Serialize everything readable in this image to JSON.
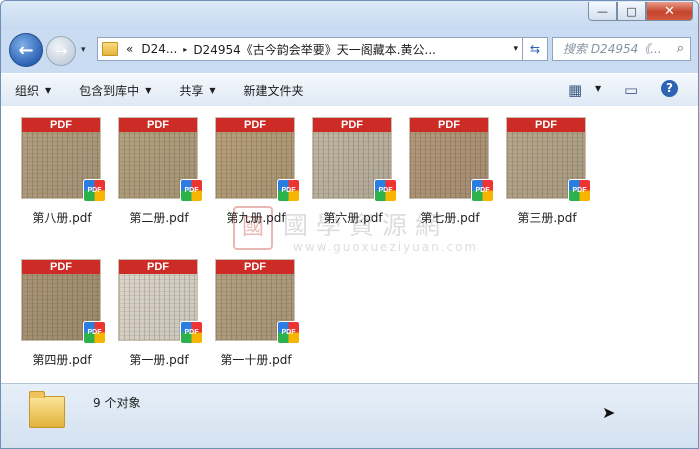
{
  "window": {
    "controls": {
      "minimize": "—",
      "maximize": "□",
      "close": "✕"
    }
  },
  "nav": {
    "back": "←",
    "forward": "→",
    "history": "▾",
    "breadcrumb": [
      "«",
      "D24...",
      "D24954《古今韵会举要》天一阁藏本.黄公..."
    ],
    "separators": [
      "▸"
    ],
    "address_dropdown": "▾",
    "refresh": "⇆",
    "search_placeholder": "搜索 D24954《...",
    "search_icon": "⌕"
  },
  "toolbar": {
    "organize": "组织",
    "include_library": "包含到库中",
    "share": "共享",
    "new_folder": "新建文件夹",
    "dropdown_arrow": "▼",
    "view_icon": "▦",
    "view_arrow": "▼",
    "pane_icon": "▭",
    "help_icon": "?"
  },
  "files": [
    {
      "name": "第八册.pdf",
      "band": "PDF",
      "badge": "PDF",
      "tone": "#b29e80"
    },
    {
      "name": "第二册.pdf",
      "band": "PDF",
      "badge": "PDF",
      "tone": "#b3a17f"
    },
    {
      "name": "第九册.pdf",
      "band": "PDF",
      "badge": "PDF",
      "tone": "#b69f7a"
    },
    {
      "name": "第六册.pdf",
      "band": "PDF",
      "badge": "PDF",
      "tone": "#bfb6a3"
    },
    {
      "name": "第七册.pdf",
      "band": "PDF",
      "badge": "PDF",
      "tone": "#b2987b"
    },
    {
      "name": "第三册.pdf",
      "band": "PDF",
      "badge": "PDF",
      "tone": "#b6a78c"
    },
    {
      "name": "第四册.pdf",
      "band": "PDF",
      "badge": "PDF",
      "tone": "#a99575"
    },
    {
      "name": "第一册.pdf",
      "band": "PDF",
      "badge": "PDF",
      "tone": "#dcd6ca"
    },
    {
      "name": "第一十册.pdf",
      "band": "PDF",
      "badge": "PDF",
      "tone": "#b3a081"
    }
  ],
  "watermark": {
    "seal": "國",
    "text": "國學資源網",
    "url": "www.guoxueziyuan.com"
  },
  "status": {
    "count": "9 个对象"
  }
}
